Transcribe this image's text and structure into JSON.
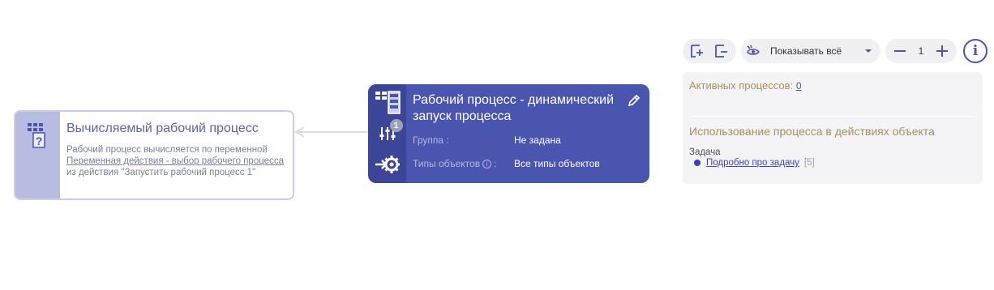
{
  "toolbar": {
    "filter_label": "Показывать всё",
    "zoom_value": "1",
    "info_label": "i"
  },
  "calc_node": {
    "title": "Вычисляемый рабочий процесс",
    "desc_part1": "Рабочий процесс вычисляется по переменной ",
    "desc_link": "Переменная действия - выбор рабочего процесса ",
    "desc_part2": "из действия \"Запустить рабочий процесс 1\""
  },
  "process_node": {
    "title": "Рабочий процесс - динамический запуск процесса",
    "badge": "1",
    "group_label": "Группа :",
    "group_value": "Не задана",
    "types_label": "Типы объектов",
    "types_colon": ":",
    "types_value": "Все типы объектов"
  },
  "panel": {
    "active_label": "Активных процессов:",
    "active_count": "0",
    "usage_title": "Использование процесса в действиях объекта",
    "object_type": "Задача",
    "item_link": "Подробно про задачу",
    "item_count": "[5]"
  },
  "colors": {
    "node_primary": "#4a55b0",
    "node_side": "#3c4699",
    "calc_side": "#b7bce0",
    "accent_gold": "#a89060"
  }
}
